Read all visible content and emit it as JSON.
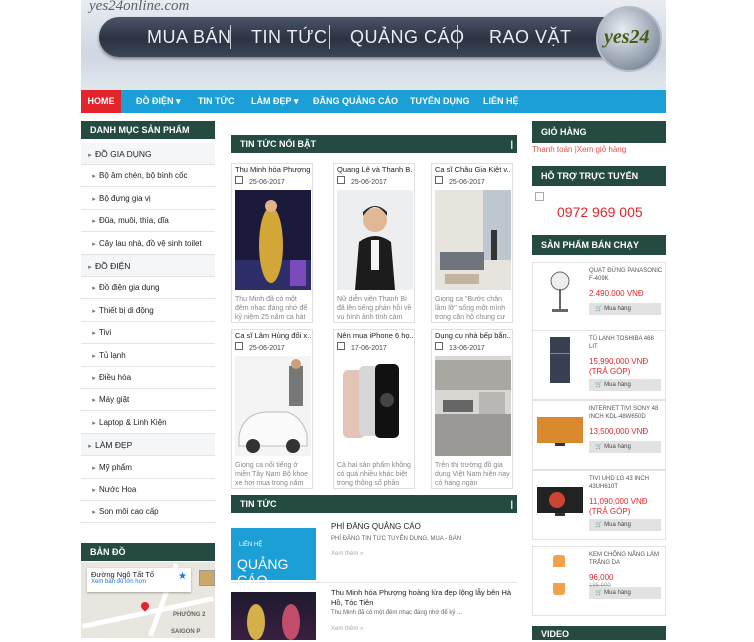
{
  "site": {
    "logo_text": "yes24online.com",
    "nav_pill": [
      "MUA BÁN",
      "TIN TỨC",
      "QUẢNG CÁO",
      "RAO VẶT"
    ],
    "badge_text": "yes24"
  },
  "menu": {
    "items": [
      {
        "label": "HOME",
        "active": true
      },
      {
        "label": "ĐỒ ĐIỆN ▾"
      },
      {
        "label": "TIN TỨC"
      },
      {
        "label": "LÀM ĐẸP ▾"
      },
      {
        "label": "ĐĂNG QUẢNG CÁO"
      },
      {
        "label": "TUYỂN DỤNG"
      },
      {
        "label": "LIÊN HỆ"
      }
    ]
  },
  "categories": {
    "header": "DANH MỤC SẢN PHẨM",
    "items": [
      {
        "label": "ĐỒ GIA DỤNG",
        "top": true
      },
      {
        "label": "Bộ âm chén, bộ bình cốc"
      },
      {
        "label": "Bộ đựng gia vị"
      },
      {
        "label": "Đũa, muôi, thìa, dĩa"
      },
      {
        "label": "Cây lau nhà, đồ vệ sinh toilet"
      },
      {
        "label": "ĐỒ ĐIỆN",
        "top": true
      },
      {
        "label": "Đồ điện gia dụng"
      },
      {
        "label": "Thiết bị di động"
      },
      {
        "label": "Tivi"
      },
      {
        "label": "Tủ lạnh"
      },
      {
        "label": "Điều hòa"
      },
      {
        "label": "Máy giặt"
      },
      {
        "label": "Laptop & Linh Kiện"
      },
      {
        "label": "LÀM ĐẸP",
        "top": true
      },
      {
        "label": "Mỹ phẩm"
      },
      {
        "label": "Nước Hoa"
      },
      {
        "label": "Son môi cao cấp"
      }
    ]
  },
  "map": {
    "header": "BẢN ĐỒ",
    "place": "Đường Ngô Tất Tố",
    "link": "Xem bản đồ lớn hơn",
    "area_label": "PHƯỜNG 2",
    "area_label2": "SAIGON P"
  },
  "featured": {
    "header": "TIN TỨC NỔI BẬT",
    "cards": [
      {
        "title": "Thu Minh hóa Phượng...",
        "date": "25-06-2017",
        "text": "Thu Minh đã có một đêm nhạc đáng nhớ để kỷ niệm 25 năm ca hát",
        "img": "performer"
      },
      {
        "title": "Quang Lê và Thanh B...",
        "date": "25-06-2017",
        "text": "Nữ diễn viên Thanh Bì đã lên tiếng phản hồi về vụ hình ảnh tình cảm",
        "img": "man"
      },
      {
        "title": "Ca sĩ Châu Gia Kiệt v...",
        "date": "25-06-2017",
        "text": "Giọng ca \"Bước chân lầm lỡ\" sống một mình trong căn hộ chung cư",
        "img": "room"
      },
      {
        "title": "Ca sĩ Lâm Hùng đổi x...",
        "date": "25-06-2017",
        "text": "Giọng ca nổi tiếng ở miền Tây Nam Bộ khoe xe hơi mua trong năm",
        "img": "car"
      },
      {
        "title": "Nên mua iPhone 6 họ...",
        "date": "17-06-2017",
        "text": "Cả hai sản phẩm không có quá nhiều khác biệt trong thông số phần",
        "img": "phone"
      },
      {
        "title": "Dụng cụ nhà bếp bắn...",
        "date": "13-06-2017",
        "text": "Trên thị trường đồ gia dụng Việt Nam hiện nay có hàng ngàn",
        "img": "kitchen"
      }
    ]
  },
  "news": {
    "header": "TIN TỨC",
    "items": [
      {
        "title": "PHÍ ĐĂNG QUẢNG CÁO",
        "desc": "PHÍ ĐĂNG TIN TỨC TUYỂN DỤNG, MUA - BÁN",
        "more": "Xem thêm »",
        "thumb_line1": "LIÊN HỆ",
        "thumb_line2": "QUẢNG CÁO"
      },
      {
        "title": "Thu Minh hóa Phượng hoàng lửa đẹp lộng lẫy bên Hà Hồ, Tóc Tiên",
        "desc": "Thu Minh đã có một đêm nhạc đáng nhớ để kỷ ...",
        "more": "Xem thêm »"
      }
    ]
  },
  "cart": {
    "header": "GIỎ HÀNG",
    "checkout": "Thanh toán",
    "view": "Xem giỏ hàng"
  },
  "support": {
    "header": "HỖ TRỢ TRỰC TUYẾN",
    "phone": "0972 969 005"
  },
  "bestsellers": {
    "header": "SẢN PHẨM BÁN CHẠY",
    "items": [
      {
        "name": "QUẠT ĐỨNG PANASONIC F-409K",
        "price": "2.490.000 VNĐ",
        "button": "Mua hàng",
        "img": "fan"
      },
      {
        "name": "TỦ LẠNH TOSHIBA 468 LIT",
        "price": "15,990,000 VNĐ (TRẢ GÓP)",
        "button": "Mua hàng",
        "img": "fridge"
      },
      {
        "name": "INTERNET TIVI SONY 48 INCH KDL-48W650D",
        "price": "13,500,000 VNĐ",
        "button": "Mua hàng",
        "img": "tv"
      },
      {
        "name": "TIVI UHD LG 43 INCH 43UH610T",
        "price": "11,090,000 VNĐ (TRẢ GÓP)",
        "button": "Mua hàng",
        "img": "tv2"
      },
      {
        "name": "KEM CHỐNG NẮNG LÀM TRẮNG DA",
        "price": "96,000",
        "old_price": "185,000",
        "button": "Mua hàng",
        "img": "cream"
      }
    ]
  },
  "video": {
    "header": "VIDEO"
  }
}
